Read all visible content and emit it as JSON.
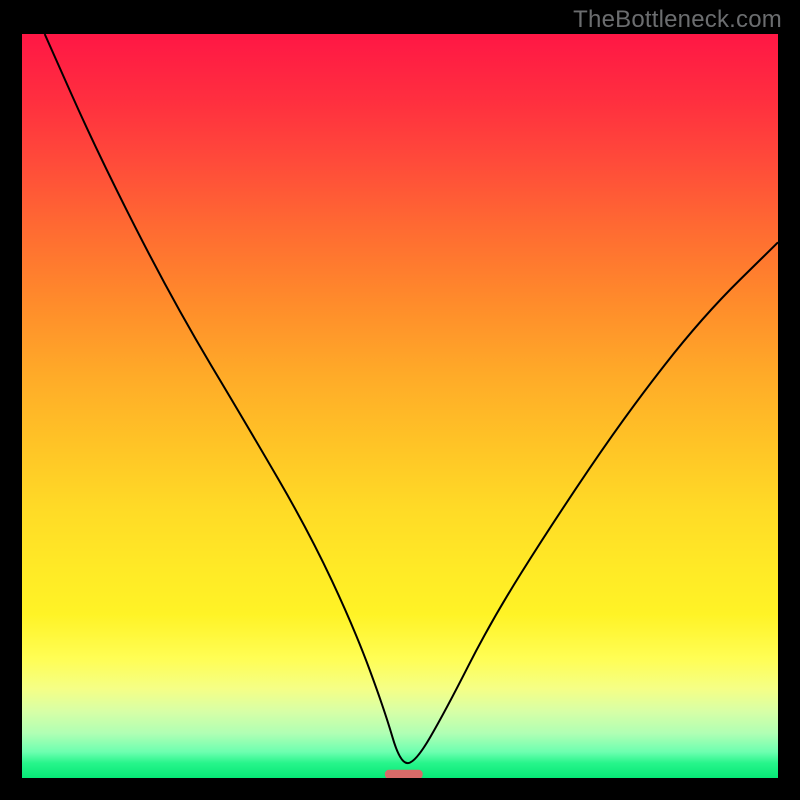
{
  "watermark": "TheBottleneck.com",
  "chart_data": {
    "type": "line",
    "title": "",
    "xlabel": "",
    "ylabel": "",
    "xlim": [
      0,
      100
    ],
    "ylim": [
      0,
      100
    ],
    "series": [
      {
        "name": "curve",
        "x": [
          3,
          10,
          20,
          30,
          38,
          44,
          48,
          50,
          52,
          56,
          62,
          70,
          80,
          90,
          100
        ],
        "values": [
          100,
          84,
          64,
          47,
          33,
          20,
          9,
          2,
          2,
          9,
          21,
          34,
          49,
          62,
          72
        ]
      }
    ],
    "marker": {
      "x_start": 48,
      "x_end": 53,
      "y": 0.5
    },
    "background_gradient": [
      {
        "stop": 0,
        "color": "#ff1745"
      },
      {
        "stop": 50,
        "color": "#ffab28"
      },
      {
        "stop": 80,
        "color": "#fffe55"
      },
      {
        "stop": 100,
        "color": "#06e876"
      }
    ]
  }
}
